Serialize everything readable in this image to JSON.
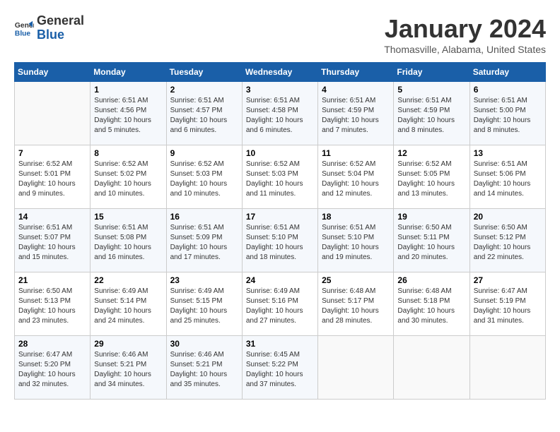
{
  "header": {
    "logo_line1": "General",
    "logo_line2": "Blue",
    "month": "January 2024",
    "location": "Thomasville, Alabama, United States"
  },
  "weekdays": [
    "Sunday",
    "Monday",
    "Tuesday",
    "Wednesday",
    "Thursday",
    "Friday",
    "Saturday"
  ],
  "weeks": [
    [
      {
        "day": "",
        "sunrise": "",
        "sunset": "",
        "daylight": ""
      },
      {
        "day": "1",
        "sunrise": "Sunrise: 6:51 AM",
        "sunset": "Sunset: 4:56 PM",
        "daylight": "Daylight: 10 hours and 5 minutes."
      },
      {
        "day": "2",
        "sunrise": "Sunrise: 6:51 AM",
        "sunset": "Sunset: 4:57 PM",
        "daylight": "Daylight: 10 hours and 6 minutes."
      },
      {
        "day": "3",
        "sunrise": "Sunrise: 6:51 AM",
        "sunset": "Sunset: 4:58 PM",
        "daylight": "Daylight: 10 hours and 6 minutes."
      },
      {
        "day": "4",
        "sunrise": "Sunrise: 6:51 AM",
        "sunset": "Sunset: 4:59 PM",
        "daylight": "Daylight: 10 hours and 7 minutes."
      },
      {
        "day": "5",
        "sunrise": "Sunrise: 6:51 AM",
        "sunset": "Sunset: 4:59 PM",
        "daylight": "Daylight: 10 hours and 8 minutes."
      },
      {
        "day": "6",
        "sunrise": "Sunrise: 6:51 AM",
        "sunset": "Sunset: 5:00 PM",
        "daylight": "Daylight: 10 hours and 8 minutes."
      }
    ],
    [
      {
        "day": "7",
        "sunrise": "Sunrise: 6:52 AM",
        "sunset": "Sunset: 5:01 PM",
        "daylight": "Daylight: 10 hours and 9 minutes."
      },
      {
        "day": "8",
        "sunrise": "Sunrise: 6:52 AM",
        "sunset": "Sunset: 5:02 PM",
        "daylight": "Daylight: 10 hours and 10 minutes."
      },
      {
        "day": "9",
        "sunrise": "Sunrise: 6:52 AM",
        "sunset": "Sunset: 5:03 PM",
        "daylight": "Daylight: 10 hours and 10 minutes."
      },
      {
        "day": "10",
        "sunrise": "Sunrise: 6:52 AM",
        "sunset": "Sunset: 5:03 PM",
        "daylight": "Daylight: 10 hours and 11 minutes."
      },
      {
        "day": "11",
        "sunrise": "Sunrise: 6:52 AM",
        "sunset": "Sunset: 5:04 PM",
        "daylight": "Daylight: 10 hours and 12 minutes."
      },
      {
        "day": "12",
        "sunrise": "Sunrise: 6:52 AM",
        "sunset": "Sunset: 5:05 PM",
        "daylight": "Daylight: 10 hours and 13 minutes."
      },
      {
        "day": "13",
        "sunrise": "Sunrise: 6:51 AM",
        "sunset": "Sunset: 5:06 PM",
        "daylight": "Daylight: 10 hours and 14 minutes."
      }
    ],
    [
      {
        "day": "14",
        "sunrise": "Sunrise: 6:51 AM",
        "sunset": "Sunset: 5:07 PM",
        "daylight": "Daylight: 10 hours and 15 minutes."
      },
      {
        "day": "15",
        "sunrise": "Sunrise: 6:51 AM",
        "sunset": "Sunset: 5:08 PM",
        "daylight": "Daylight: 10 hours and 16 minutes."
      },
      {
        "day": "16",
        "sunrise": "Sunrise: 6:51 AM",
        "sunset": "Sunset: 5:09 PM",
        "daylight": "Daylight: 10 hours and 17 minutes."
      },
      {
        "day": "17",
        "sunrise": "Sunrise: 6:51 AM",
        "sunset": "Sunset: 5:10 PM",
        "daylight": "Daylight: 10 hours and 18 minutes."
      },
      {
        "day": "18",
        "sunrise": "Sunrise: 6:51 AM",
        "sunset": "Sunset: 5:10 PM",
        "daylight": "Daylight: 10 hours and 19 minutes."
      },
      {
        "day": "19",
        "sunrise": "Sunrise: 6:50 AM",
        "sunset": "Sunset: 5:11 PM",
        "daylight": "Daylight: 10 hours and 20 minutes."
      },
      {
        "day": "20",
        "sunrise": "Sunrise: 6:50 AM",
        "sunset": "Sunset: 5:12 PM",
        "daylight": "Daylight: 10 hours and 22 minutes."
      }
    ],
    [
      {
        "day": "21",
        "sunrise": "Sunrise: 6:50 AM",
        "sunset": "Sunset: 5:13 PM",
        "daylight": "Daylight: 10 hours and 23 minutes."
      },
      {
        "day": "22",
        "sunrise": "Sunrise: 6:49 AM",
        "sunset": "Sunset: 5:14 PM",
        "daylight": "Daylight: 10 hours and 24 minutes."
      },
      {
        "day": "23",
        "sunrise": "Sunrise: 6:49 AM",
        "sunset": "Sunset: 5:15 PM",
        "daylight": "Daylight: 10 hours and 25 minutes."
      },
      {
        "day": "24",
        "sunrise": "Sunrise: 6:49 AM",
        "sunset": "Sunset: 5:16 PM",
        "daylight": "Daylight: 10 hours and 27 minutes."
      },
      {
        "day": "25",
        "sunrise": "Sunrise: 6:48 AM",
        "sunset": "Sunset: 5:17 PM",
        "daylight": "Daylight: 10 hours and 28 minutes."
      },
      {
        "day": "26",
        "sunrise": "Sunrise: 6:48 AM",
        "sunset": "Sunset: 5:18 PM",
        "daylight": "Daylight: 10 hours and 30 minutes."
      },
      {
        "day": "27",
        "sunrise": "Sunrise: 6:47 AM",
        "sunset": "Sunset: 5:19 PM",
        "daylight": "Daylight: 10 hours and 31 minutes."
      }
    ],
    [
      {
        "day": "28",
        "sunrise": "Sunrise: 6:47 AM",
        "sunset": "Sunset: 5:20 PM",
        "daylight": "Daylight: 10 hours and 32 minutes."
      },
      {
        "day": "29",
        "sunrise": "Sunrise: 6:46 AM",
        "sunset": "Sunset: 5:21 PM",
        "daylight": "Daylight: 10 hours and 34 minutes."
      },
      {
        "day": "30",
        "sunrise": "Sunrise: 6:46 AM",
        "sunset": "Sunset: 5:21 PM",
        "daylight": "Daylight: 10 hours and 35 minutes."
      },
      {
        "day": "31",
        "sunrise": "Sunrise: 6:45 AM",
        "sunset": "Sunset: 5:22 PM",
        "daylight": "Daylight: 10 hours and 37 minutes."
      },
      {
        "day": "",
        "sunrise": "",
        "sunset": "",
        "daylight": ""
      },
      {
        "day": "",
        "sunrise": "",
        "sunset": "",
        "daylight": ""
      },
      {
        "day": "",
        "sunrise": "",
        "sunset": "",
        "daylight": ""
      }
    ]
  ]
}
